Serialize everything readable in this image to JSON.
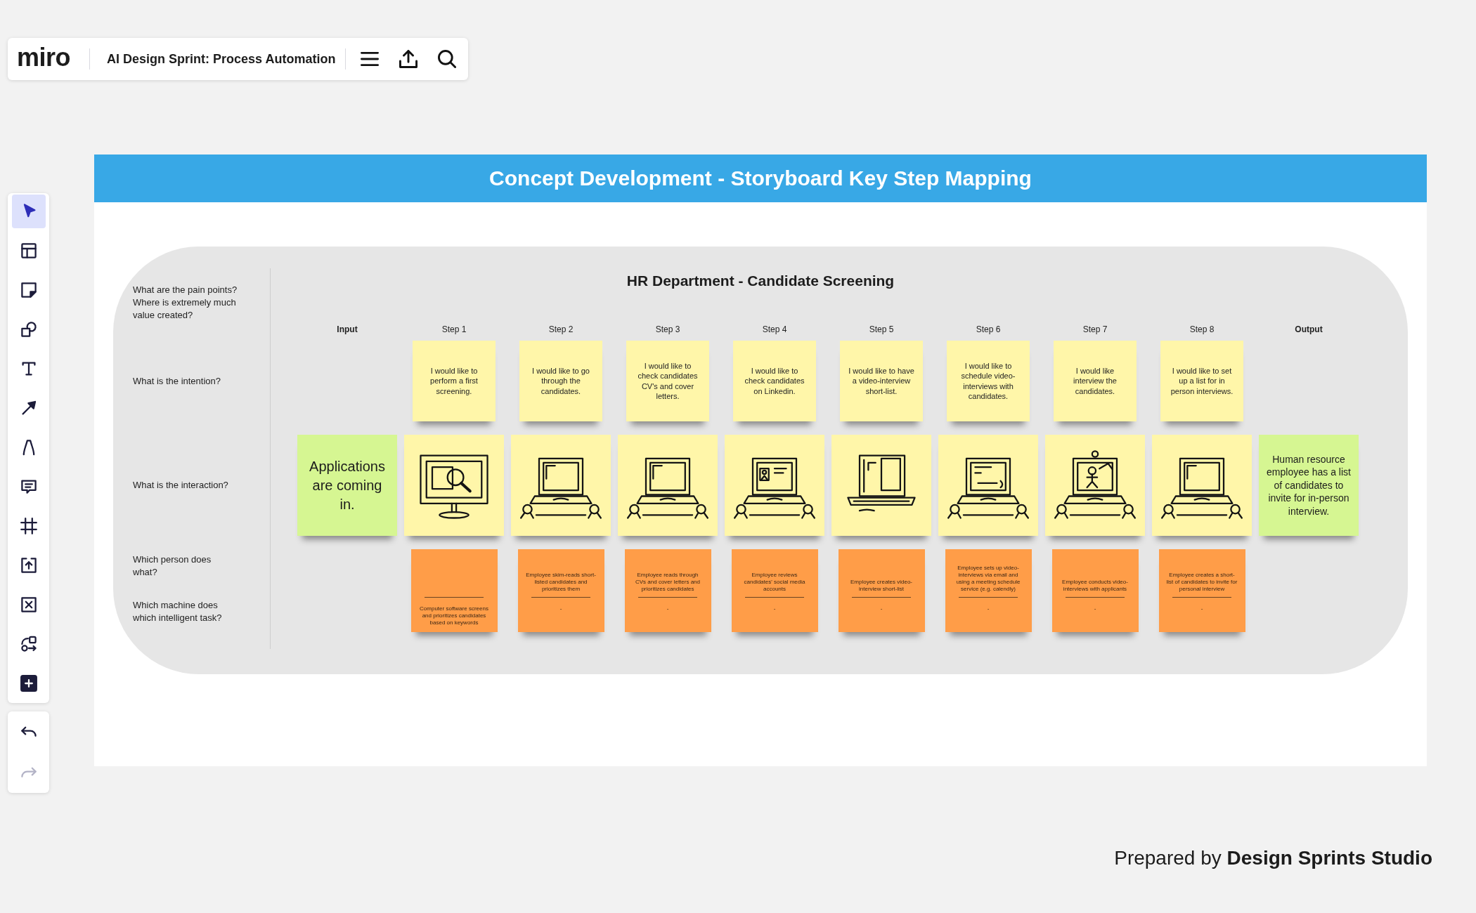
{
  "topbar": {
    "logo": "miro",
    "board_title": "AI Design Sprint: Process Automation"
  },
  "tools": [
    {
      "kind": "select",
      "selected": true
    },
    {
      "kind": "templates",
      "selected": false
    },
    {
      "kind": "sticky",
      "selected": false
    },
    {
      "kind": "shapes",
      "selected": false
    },
    {
      "kind": "text",
      "selected": false
    },
    {
      "kind": "line",
      "selected": false
    },
    {
      "kind": "pen",
      "selected": false
    },
    {
      "kind": "comment",
      "selected": false
    },
    {
      "kind": "frame",
      "selected": false
    },
    {
      "kind": "upload",
      "selected": false
    },
    {
      "kind": "embed",
      "selected": false
    },
    {
      "kind": "diagram",
      "selected": false
    },
    {
      "kind": "apps",
      "selected": false
    }
  ],
  "history": [
    {
      "kind": "undo",
      "disabled": false
    },
    {
      "kind": "redo",
      "disabled": true
    }
  ],
  "banner": {
    "title": "Concept Development - Storyboard Key Step Mapping"
  },
  "storyboard": {
    "title": "HR Department - Candidate Screening",
    "row_labels": {
      "pain_points": "What are the pain points? Where is extremely much value created?",
      "intention": "What is the intention?",
      "interaction": "What is the interaction?",
      "person": "Which person does what?",
      "machine": "Which machine does which intelligent task?"
    },
    "columns": [
      {
        "kind": "input",
        "heading": "Input",
        "interaction": {
          "kind": "note",
          "text": "Applications are coming in."
        }
      },
      {
        "kind": "step",
        "heading": "Step 1",
        "intention": "I would like to perform a first screening.",
        "interaction": {
          "kind": "monitor"
        },
        "task": {
          "machine": "Computer software screens and prioritizes candidates based on keywords"
        }
      },
      {
        "kind": "step",
        "heading": "Step 2",
        "intention": "I would like to go through the candidates.",
        "interaction": {
          "kind": "laptop"
        },
        "task": {
          "person": "Employee skim-reads short-listed candidates and prioritizes them",
          "machine": "-"
        }
      },
      {
        "kind": "step",
        "heading": "Step 3",
        "intention": "I would like to check candidates CV's and cover letters.",
        "interaction": {
          "kind": "laptop"
        },
        "task": {
          "person": "Employee reads through CVs and cover letters and prioritizes candidates",
          "machine": "-"
        }
      },
      {
        "kind": "step",
        "heading": "Step 4",
        "intention": "I would like to check candidates on Linkedin.",
        "interaction": {
          "kind": "profile"
        },
        "task": {
          "person": "Employee reviews candidates' social media accounts",
          "machine": "-"
        }
      },
      {
        "kind": "step",
        "heading": "Step 5",
        "intention": "I would like to have a video-interview short-list.",
        "interaction": {
          "kind": "document"
        },
        "task": {
          "person": "Employee creates video-interview short-list",
          "machine": "-"
        }
      },
      {
        "kind": "step",
        "heading": "Step 6",
        "intention": "I would like to schedule video-interviews with candidates.",
        "interaction": {
          "kind": "letter"
        },
        "task": {
          "person": "Employee sets up video-interviews via email and using a meeting schedule service (e.g. calendly)",
          "machine": "-"
        }
      },
      {
        "kind": "step",
        "heading": "Step 7",
        "intention": "I would like interview the candidates.",
        "interaction": {
          "kind": "videocall"
        },
        "task": {
          "person": "Employee conducts video-interviews with applicants",
          "machine": "-"
        }
      },
      {
        "kind": "step",
        "heading": "Step 8",
        "intention": "I would like to set up a list for in person interviews.",
        "interaction": {
          "kind": "laptop"
        },
        "task": {
          "person": "Employee creates a short-list of candidates to invite for personal interview",
          "machine": "-"
        }
      },
      {
        "kind": "output",
        "heading": "Output",
        "interaction": {
          "kind": "note",
          "text": "Human resource employee has a list of candidates to invite for in-person interview."
        }
      }
    ]
  },
  "credit": "Prepared by **Design Sprints Studio**"
}
